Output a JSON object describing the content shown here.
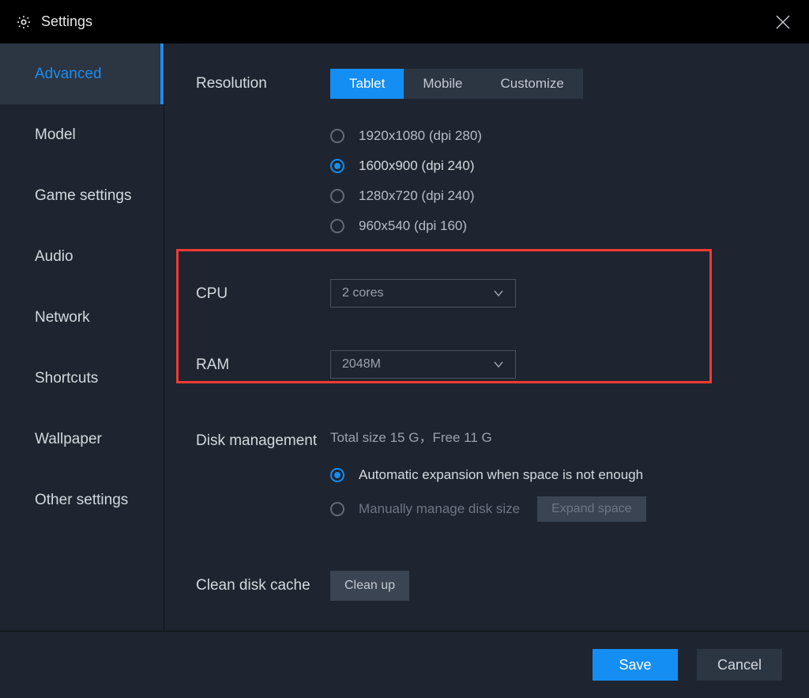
{
  "header": {
    "title": "Settings"
  },
  "sidebar": {
    "items": [
      {
        "label": "Advanced",
        "active": true
      },
      {
        "label": "Model"
      },
      {
        "label": "Game settings"
      },
      {
        "label": "Audio"
      },
      {
        "label": "Network"
      },
      {
        "label": "Shortcuts"
      },
      {
        "label": "Wallpaper"
      },
      {
        "label": "Other settings"
      }
    ]
  },
  "resolution": {
    "label": "Resolution",
    "tabs": [
      {
        "label": "Tablet",
        "active": true
      },
      {
        "label": "Mobile"
      },
      {
        "label": "Customize"
      }
    ],
    "options": [
      {
        "label": "1920x1080  (dpi 280)",
        "checked": false
      },
      {
        "label": "1600x900  (dpi 240)",
        "checked": true
      },
      {
        "label": "1280x720  (dpi 240)",
        "checked": false
      },
      {
        "label": "960x540  (dpi 160)",
        "checked": false
      }
    ]
  },
  "cpu": {
    "label": "CPU",
    "value": "2 cores"
  },
  "ram": {
    "label": "RAM",
    "value": "2048M"
  },
  "disk": {
    "label": "Disk management",
    "status": "Total size 15 G，Free 11 G",
    "auto_label": "Automatic expansion when space is not enough",
    "manual_label": "Manually manage disk size",
    "expand_label": "Expand space",
    "auto_checked": true
  },
  "cache": {
    "label": "Clean disk cache",
    "button": "Clean up"
  },
  "footer": {
    "save": "Save",
    "cancel": "Cancel"
  }
}
